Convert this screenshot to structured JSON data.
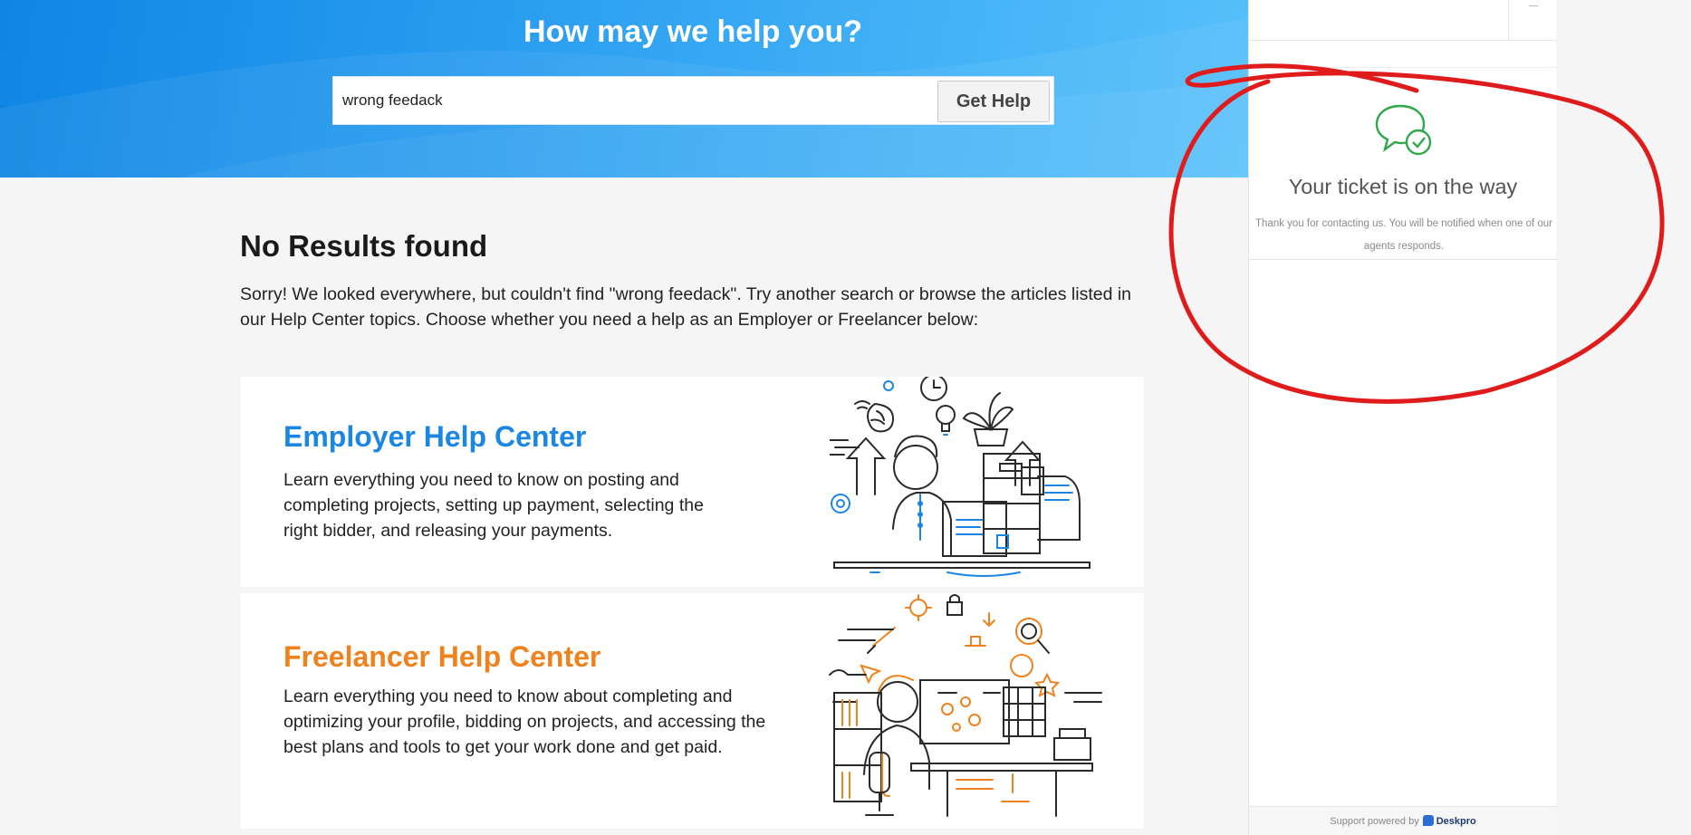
{
  "hero": {
    "title": "How may we help you?",
    "search_value": "wrong feedack",
    "search_button": "Get Help"
  },
  "results": {
    "title": "No Results found",
    "message": "Sorry! We looked everywhere, but couldn't find \"wrong feedack\". Try another search or browse the articles listed in our Help Center topics. Choose whether you need a help as an Employer or Freelancer below:"
  },
  "cards": [
    {
      "title": "Employer Help Center",
      "description": "Learn everything you need to know on posting and completing projects, setting up payment, selecting the right bidder, and releasing your payments.",
      "accent": "#1a87e4"
    },
    {
      "title": "Freelancer Help Center",
      "description": "Learn everything you need to know about completing and optimizing your profile, bidding on projects, and accessing the best plans and tools to get your work done and get paid.",
      "accent": "#f0821e"
    }
  ],
  "panel": {
    "ticket_title": "Your ticket is on the way",
    "ticket_text": "Thank you for contacting us. You will be notified when one of our agents responds.",
    "powered_text": "Support powered by",
    "powered_brand": "Deskpro",
    "success_color": "#2ea84a"
  },
  "annotation": {
    "color": "#e01b1b"
  }
}
